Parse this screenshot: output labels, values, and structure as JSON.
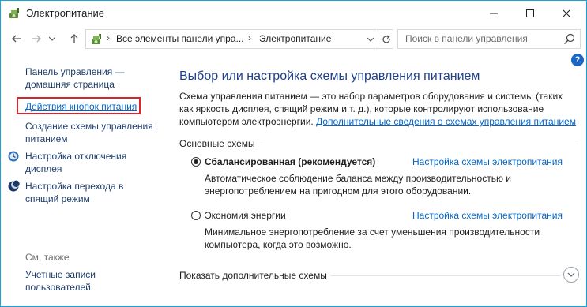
{
  "window": {
    "title": "Электропитание",
    "accent_color": "#1aa0d8"
  },
  "address": {
    "crumbs": [
      "Все элементы панели упра...",
      "Электропитание"
    ],
    "search_placeholder": "Поиск в панели управления"
  },
  "help": {
    "label": "?"
  },
  "sidebar": {
    "home_line1": "Панель управления —",
    "home_line2": "домашняя страница",
    "power_buttons": "Действия кнопок питания",
    "create_plan_line1": "Создание схемы управления",
    "create_plan_line2": "питанием",
    "display_off_line1": "Настройка отключения",
    "display_off_line2": "дисплея",
    "sleep_line1": "Настройка перехода в",
    "sleep_line2": "спящий режим",
    "see_also": "См. также",
    "accounts_line1": "Учетные записи",
    "accounts_line2": "пользователей"
  },
  "main": {
    "title": "Выбор или настройка схемы управления питанием",
    "description": "Схема управления питанием — это набор параметров оборудования и системы (таких как яркость дисплея, спящий режим и т. д.), которые контролируют использование компьютером электроэнергии. ",
    "description_link": "Дополнительные сведения о схемах управления питанием",
    "group_label": "Основные схемы",
    "plans": [
      {
        "name": "Сбалансированная (рекомендуется)",
        "selected": true,
        "link": "Настройка схемы электропитания",
        "description": "Автоматическое соблюдение баланса между производительностью и энергопотреблением на пригодном для этого оборудовании."
      },
      {
        "name": "Экономия энергии",
        "selected": false,
        "link": "Настройка схемы электропитания",
        "description": "Минимальное энергопотребление за счет уменьшения производительности компьютера, когда это возможно."
      }
    ],
    "more_plans": "Показать дополнительные схемы"
  }
}
